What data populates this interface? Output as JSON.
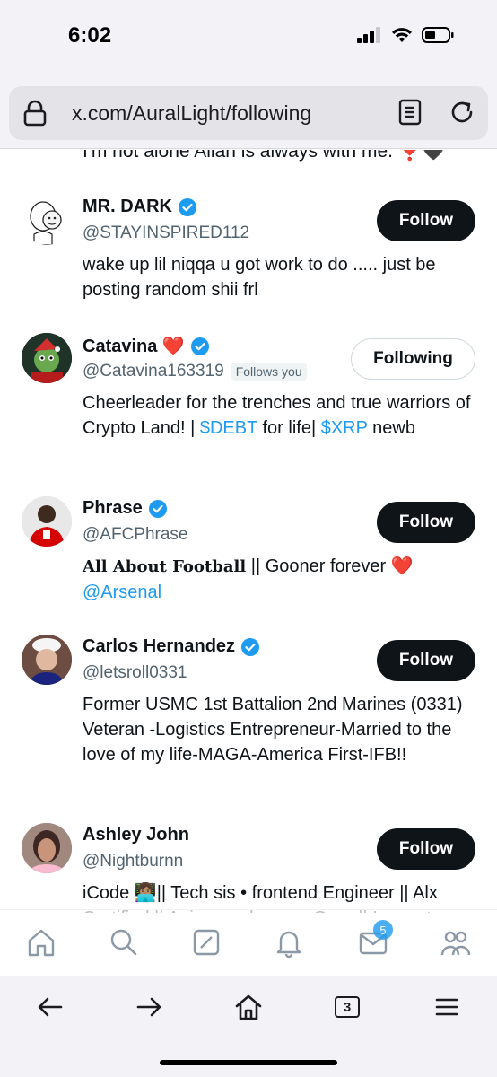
{
  "status": {
    "time": "6:02"
  },
  "browser": {
    "url": "x.com/AuralLight/following",
    "tabs_count": "3"
  },
  "feed": {
    "cut_text": "I'm not alone Allah is always with me. ❣️🖤",
    "users": [
      {
        "name": "MR. DARK",
        "handle": "@STAYINSPIRED112",
        "button": "Follow",
        "bio": "wake up lil niqqa u got work to do ..... just be posting random shii frl"
      },
      {
        "name": "Catavina ❤️",
        "handle": "@Catavina163319",
        "follows_you": "Follows you",
        "button": "Following",
        "bio_parts": [
          "Cheerleader for the trenches and true warriors of Crypto Land! | ",
          "$DEBT",
          " for life| ",
          "$XRP",
          " newb"
        ]
      },
      {
        "name": "Phrase",
        "handle": "@AFCPhrase",
        "button": "Follow",
        "bio_parts": [
          "All About Football",
          " || Gooner forever ❤️ ",
          "@Arsenal"
        ]
      },
      {
        "name": "Carlos Hernandez",
        "handle": "@letsroll0331",
        "button": "Follow",
        "bio": "Former USMC 1st Battalion 2nd Marines (0331) Veteran -Logistics Entrepreneur-Married to the love of my life-MAGA-America First-IFB!!"
      },
      {
        "name": "Ashley John",
        "handle": "@Nightburnn",
        "button": "Follow",
        "bio": "iCode 👩🏽‍💻|| Tech sis • frontend Engineer || Alx Certified || Anime and meme Guru || Innovate • Create • Dominate"
      }
    ]
  },
  "tabbar": {
    "messages_badge": "5"
  },
  "icons": {
    "home": "home-icon",
    "search": "search-icon",
    "grok": "grok-icon",
    "notifications": "bell-icon",
    "messages": "mail-icon",
    "communities": "people-icon"
  },
  "colors": {
    "accent": "#1d9bf0",
    "text": "#0f1419",
    "secondary": "#536471"
  }
}
